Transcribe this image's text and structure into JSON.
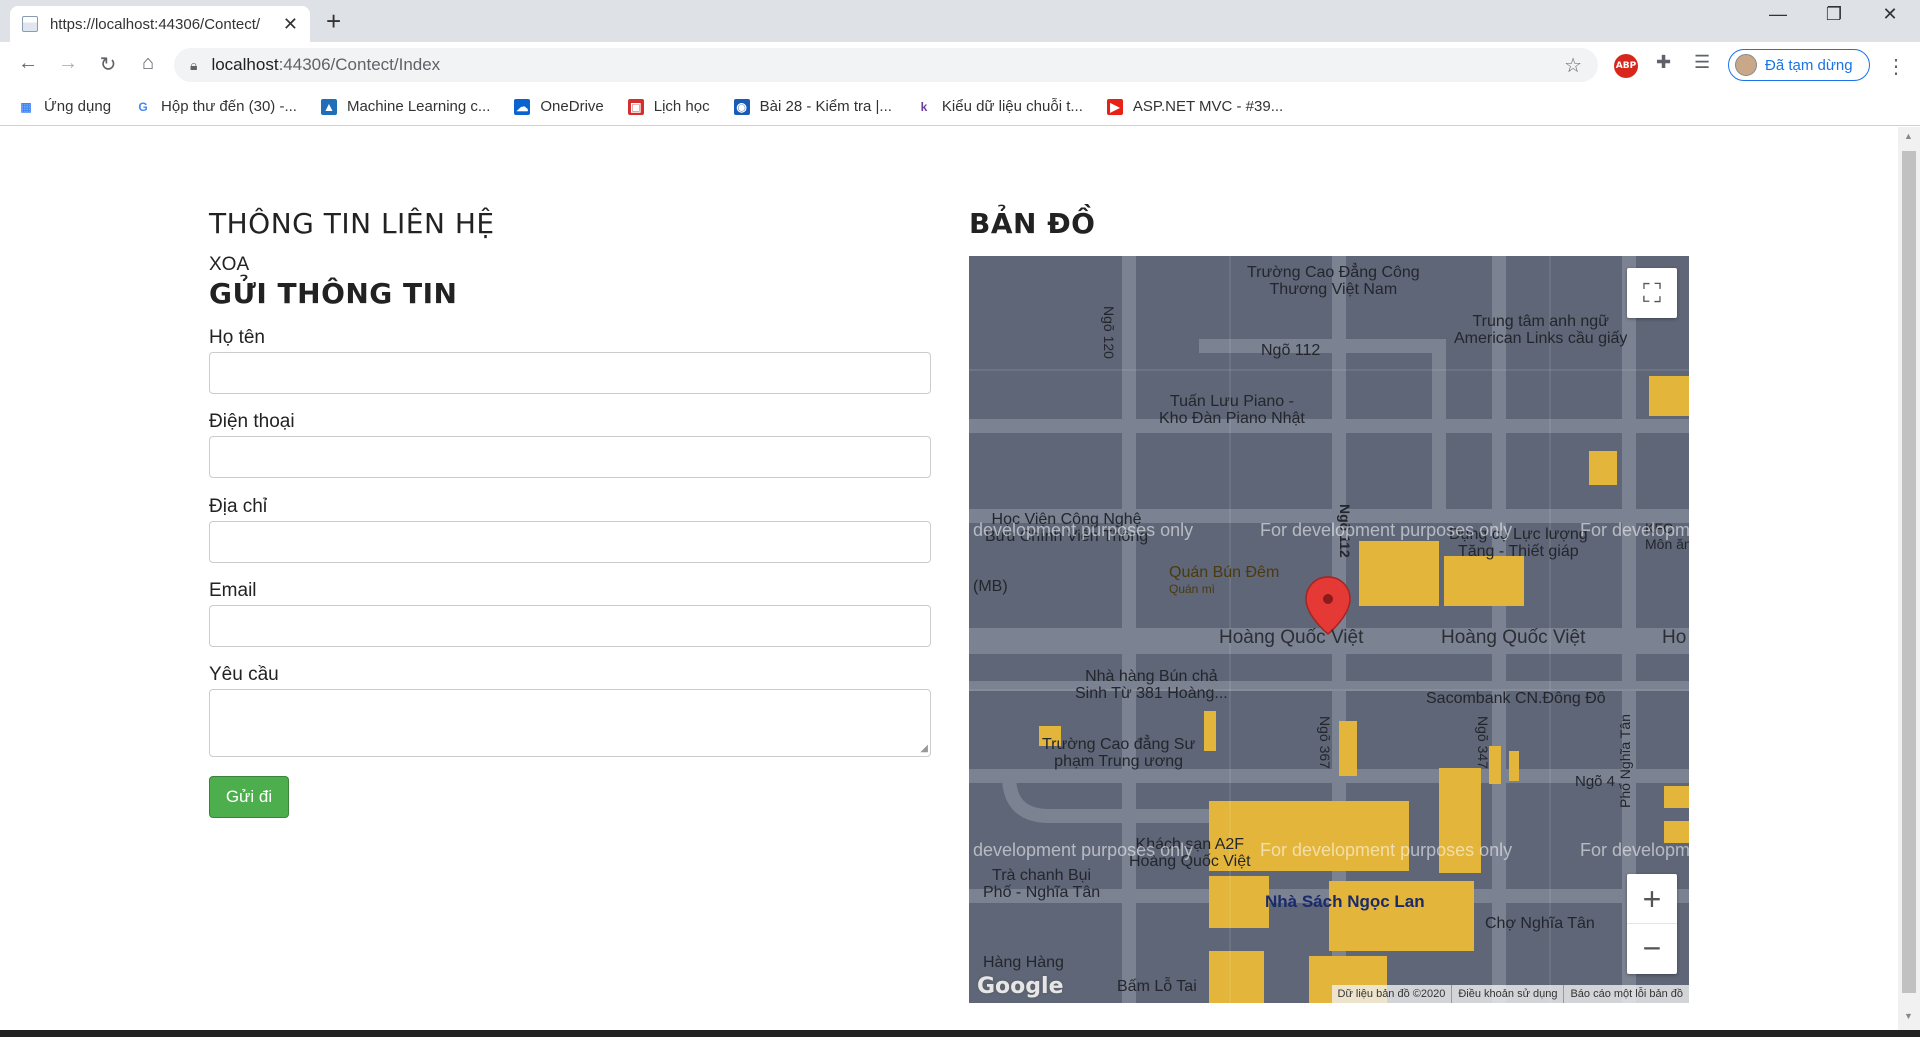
{
  "browser": {
    "tab_title": "https://localhost:44306/Contect/",
    "tab_close": "✕",
    "new_tab": "+",
    "url_host": "localhost",
    "url_path": ":44306/Contect/Index",
    "profile_label": "Đã tạm dừng",
    "bookmarks": [
      {
        "label": "Ứng dụng",
        "icon": "apps-grid-icon",
        "color": "#4285f4"
      },
      {
        "label": "Hộp thư đến (30) -...",
        "icon": "google-icon",
        "color": "#4285f4"
      },
      {
        "label": "Machine Learning c...",
        "icon": "ml-icon",
        "color": "#1e6fb8"
      },
      {
        "label": "OneDrive",
        "icon": "onedrive-icon",
        "color": "#0a64d0"
      },
      {
        "label": "Lịch học",
        "icon": "calendar-icon",
        "color": "#d32f2f"
      },
      {
        "label": "Bài 28 - Kiểm tra |...",
        "icon": "site-icon",
        "color": "#1a5bb8"
      },
      {
        "label": "Kiểu dữ liệu chuỗi t...",
        "icon": "k-icon",
        "color": "#6a3fa0"
      },
      {
        "label": "ASP.NET MVC - #39...",
        "icon": "youtube-icon",
        "color": "#e62117"
      }
    ]
  },
  "contact": {
    "heading": "THÔNG TIN LIÊN HỆ",
    "xoa": "XOA",
    "send_heading": "GỬI THÔNG TIN",
    "fields": [
      {
        "label": "Họ tên",
        "value": ""
      },
      {
        "label": "Điện thoại",
        "value": ""
      },
      {
        "label": "Địa chỉ",
        "value": ""
      },
      {
        "label": "Email",
        "value": ""
      }
    ],
    "request_label": "Yêu cầu",
    "request_value": "",
    "submit_label": "Gửi đi"
  },
  "map": {
    "heading": "BẢN ĐỒ",
    "labels": {
      "college": "Trường Cao Đẳng Công\nThương Việt Nam",
      "ngo120": "Ngõ 120",
      "ngo112_top": "Ngõ 112",
      "american_links": "Trung tâm anh ngữ\nAmerican Links cầu giấy",
      "piano": "Tuấn Lưu Piano -\nKho Đàn Piano Nhật",
      "hocvien": "Học Viện Công Nghệ\nBưu Chính Viễn Thông",
      "ngo112_mid": "Ngõ 112",
      "dungcu": "Dụng cụ Lực lượng\nTăng - Thiết giáp",
      "kfc": "KFC\nMôn ăn",
      "bun_dem": "Quán Bún Đêm",
      "bun_dem_sub": "Quán mì",
      "mb": "(MB)",
      "road1": "Hoàng Quốc Việt",
      "road2": "Hoàng Quốc Việt",
      "road3": "Ho",
      "nhahang": "Nhà hàng Bún chả\nSinh Từ 381 Hoàng...",
      "sacombank": "Sacombank CN.Đông Đô",
      "supham": "Trường Cao đẳng Sư\nphạm Trung ương",
      "ngo367": "Ngõ 367",
      "ngo347": "Ngõ 347",
      "ngo4": "Ngõ 4",
      "phonghiatan": "Phố Nghĩa Tân",
      "khachsan": "Khách sạn A2F\nHoàng Quốc Việt",
      "trachanh": "Trà chanh Bụi\nPhố - Nghĩa Tân",
      "nhasach": "Nhà Sách Ngọc Lan",
      "chonghiatan": "Chợ Nghĩa Tân",
      "hanghang": "Hàng Hàng",
      "bamlotai": "Bấm Lỗ Tai",
      "dev_watermark": "For development purposes only",
      "dev_watermark_left": "development purposes only",
      "dev_watermark_right": "For developm"
    },
    "footer": [
      "Dữ liệu bản đồ ©2020",
      "Điều khoản sử dụng",
      "Báo cáo một lỗi bản đồ"
    ],
    "google_logo": "Google",
    "zoom_in": "+",
    "zoom_out": "−",
    "fullscreen": "⛶",
    "colors": {
      "base": "#5e6677",
      "building": "#e3b53a",
      "road": "#7b8291",
      "marker": "#e53935"
    }
  }
}
